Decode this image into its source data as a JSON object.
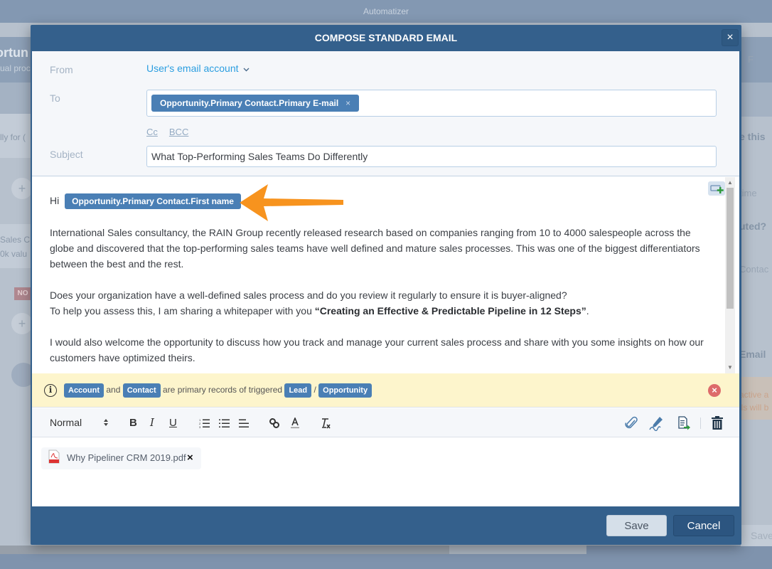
{
  "app": {
    "title": "Automatizer"
  },
  "background": {
    "header_title": "ortun",
    "header_sub": "ual proc",
    "left_card1": "lly for (",
    "left_card2_line1": "Sales C",
    "left_card2_line2": "0k valu",
    "no_badge": "NO",
    "plus": "+",
    "right_refresh": "F",
    "right_q1": "e this",
    "right_time": "time",
    "right_q2": "uted?",
    "right_contact": "Contac",
    "right_email": "Email",
    "right_warn1": "active a",
    "right_warn2": "ils will b",
    "right_save": "Save"
  },
  "modal": {
    "title": "COMPOSE STANDARD EMAIL",
    "close_label": "×",
    "from": {
      "label": "From",
      "value": "User's email account",
      "chevron": "⌄"
    },
    "to": {
      "label": "To",
      "tokens": [
        {
          "label": "Opportunity.Primary Contact.Primary E-mail",
          "remove": "×"
        }
      ]
    },
    "cc_label": "Cc",
    "bcc_label": "BCC",
    "subject": {
      "label": "Subject",
      "value": "What Top-Performing Sales Teams Do Differently"
    },
    "body": {
      "greeting": "Hi",
      "greeting_token": "Opportunity.Primary Contact.First name",
      "para1": "International Sales consultancy, the RAIN Group recently released research based on companies ranging from 10 to 4000 salespeople across the globe and discovered that the top-performing sales teams have well defined and mature sales processes. This was one of the biggest differentiators between the best and the rest.",
      "para2_line1": "Does your organization have a well-defined sales process and do you review it regularly to ensure it is buyer-aligned?",
      "para2_line2_prefix": "To help you assess this, I am sharing a whitepaper with you ",
      "para2_line2_bold": "“Creating an Effective & Predictable Pipeline in 12 Steps”",
      "para2_line2_suffix": ".",
      "para3": "I would also welcome the opportunity to discuss how you track and manage your current sales process and share with you some insights on how our customers have optimized theirs."
    },
    "info": {
      "icon": "i",
      "token_account": "Account",
      "and": "and",
      "token_contact": "Contact",
      "text": "are primary records of triggered",
      "token_lead": "Lead",
      "slash": "/",
      "token_opportunity": "Opportunity",
      "close": "×"
    },
    "toolbar": {
      "format_select": "Normal",
      "format_arrows": "⬍",
      "bold": "B",
      "italic": "I",
      "underline": "U"
    },
    "attachments": [
      {
        "name": "Why Pipeliner CRM 2019.pdf",
        "remove": "×"
      }
    ],
    "footer": {
      "save_label": "Save",
      "cancel_label": "Cancel"
    }
  }
}
